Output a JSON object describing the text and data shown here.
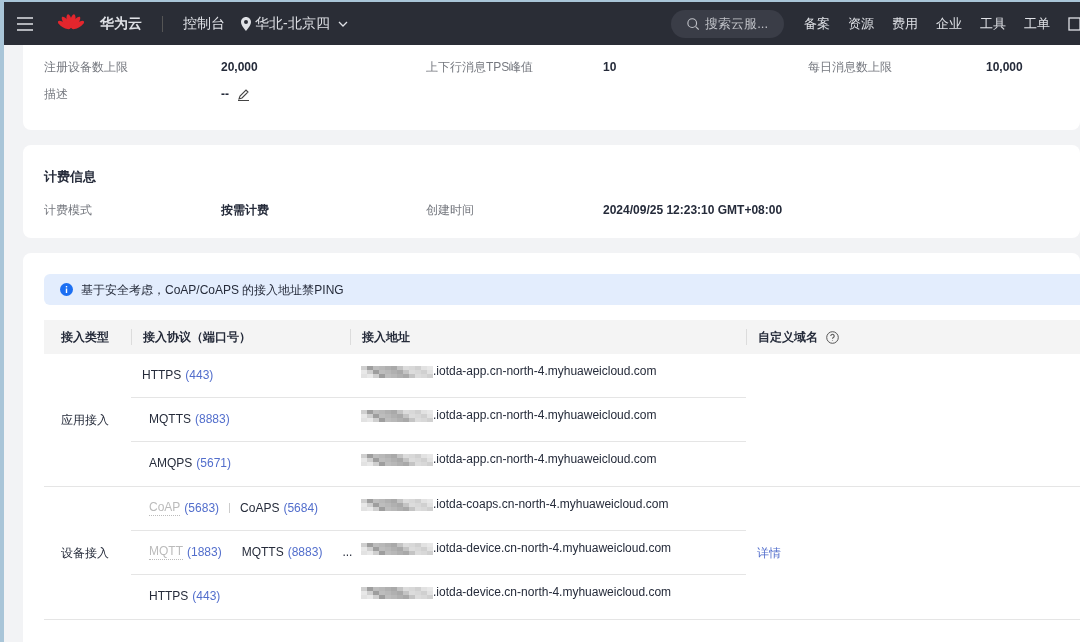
{
  "header": {
    "brand": "华为云",
    "console": "控制台",
    "region": "华北-北京四",
    "search_placeholder": "搜索云服...",
    "nav": [
      "备案",
      "资源",
      "费用",
      "企业",
      "工具",
      "工单"
    ]
  },
  "basic_info": {
    "rows": [
      [
        {
          "label": "注册设备数上限",
          "value": "20,000"
        },
        {
          "label": "上下行消息TPS峰值",
          "value": "10"
        },
        {
          "label": "每日消息数上限",
          "value": "10,000"
        }
      ],
      [
        {
          "label": "描述",
          "value": "--",
          "editable": true
        }
      ]
    ]
  },
  "billing": {
    "title": "计费信息",
    "fields": [
      {
        "label": "计费模式",
        "value": "按需计费"
      },
      {
        "label": "创建时间",
        "value": "2024/09/25 12:23:10 GMT+08:00"
      }
    ]
  },
  "access": {
    "notice": "基于安全考虑，CoAP/CoAPS 的接入地址禁PING",
    "columns": [
      "接入类型",
      "接入协议（端口号）",
      "接入地址",
      "自定义域名"
    ],
    "groups": [
      {
        "type": "应用接入",
        "rows": [
          {
            "protocols": [
              {
                "name": "HTTPS",
                "port": "(443)",
                "disabled": false
              }
            ],
            "address": ".iotda-app.cn-north-4.myhuaweicloud.com"
          },
          {
            "protocols": [
              {
                "name": "MQTTS",
                "port": "(8883)",
                "disabled": false
              }
            ],
            "address": ".iotda-app.cn-north-4.myhuaweicloud.com"
          },
          {
            "protocols": [
              {
                "name": "AMQPS",
                "port": "(5671)",
                "disabled": false
              }
            ],
            "address": ".iotda-app.cn-north-4.myhuaweicloud.com"
          }
        ]
      },
      {
        "type": "设备接入",
        "link": "详情",
        "rows": [
          {
            "protocols": [
              {
                "name": "CoAP",
                "port": "(5683)",
                "disabled": true
              },
              {
                "name": "CoAPS",
                "port": "(5684)",
                "disabled": false
              }
            ],
            "address": ".iotda-coaps.cn-north-4.myhuaweicloud.com"
          },
          {
            "protocols": [
              {
                "name": "MQTT",
                "port": "(1883)",
                "disabled": true
              },
              {
                "name": "MQTTS",
                "port": "(8883)",
                "disabled": false
              }
            ],
            "more": "...",
            "address": ".iotda-device.cn-north-4.myhuaweicloud.com"
          },
          {
            "protocols": [
              {
                "name": "HTTPS",
                "port": "(443)",
                "disabled": false
              }
            ],
            "address": ".iotda-device.cn-north-4.myhuaweicloud.com"
          }
        ]
      }
    ]
  }
}
